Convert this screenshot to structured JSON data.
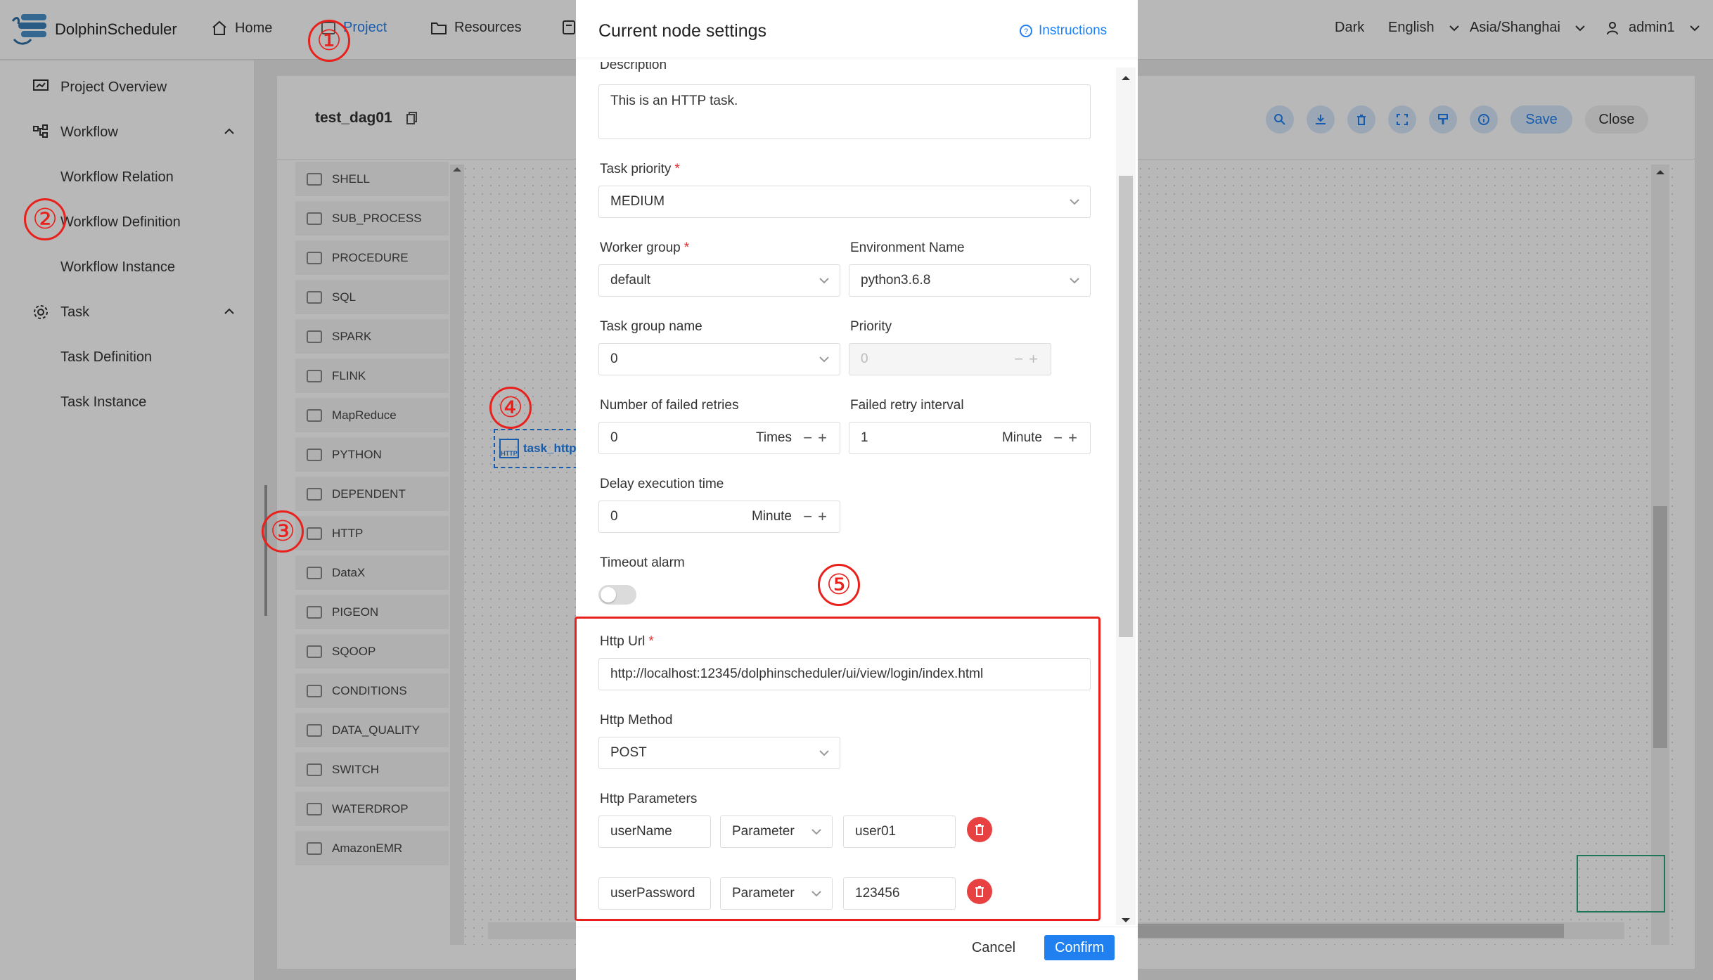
{
  "header": {
    "app_name": "DolphinScheduler",
    "nav": [
      {
        "label": "Home",
        "icon": "home-icon"
      },
      {
        "label": "Project",
        "icon": "project-icon"
      },
      {
        "label": "Resources",
        "icon": "folder-icon"
      }
    ],
    "theme": "Dark",
    "language": "English",
    "timezone": "Asia/Shanghai",
    "user": "admin1"
  },
  "sidebar": {
    "items": [
      {
        "label": "Project Overview",
        "icon": "chart-icon"
      },
      {
        "label": "Workflow",
        "icon": "workflow-icon"
      },
      {
        "label": "Workflow Relation"
      },
      {
        "label": "Workflow Definition"
      },
      {
        "label": "Workflow Instance"
      },
      {
        "label": "Task",
        "icon": "gear-icon"
      },
      {
        "label": "Task Definition"
      },
      {
        "label": "Task Instance"
      }
    ]
  },
  "canvas": {
    "dag_name": "test_dag01",
    "save_label": "Save",
    "close_label": "Close",
    "node_label": "task_http",
    "node_badge": "HTTP",
    "palette": [
      "SHELL",
      "SUB_PROCESS",
      "PROCEDURE",
      "SQL",
      "SPARK",
      "FLINK",
      "MapReduce",
      "PYTHON",
      "DEPENDENT",
      "HTTP",
      "DataX",
      "PIGEON",
      "SQOOP",
      "CONDITIONS",
      "DATA_QUALITY",
      "SWITCH",
      "WATERDROP",
      "AmazonEMR"
    ]
  },
  "annotations": [
    "①",
    "②",
    "③",
    "④",
    "⑤"
  ],
  "drawer": {
    "title": "Current node settings",
    "instructions": "Instructions",
    "description_label": "Description",
    "description_value": "This is an HTTP task.",
    "task_priority_label": "Task priority",
    "task_priority_value": "MEDIUM",
    "worker_group_label": "Worker group",
    "worker_group_value": "default",
    "environment_label": "Environment Name",
    "environment_value": "python3.6.8",
    "task_group_label": "Task group name",
    "task_group_value": "0",
    "priority_label": "Priority",
    "priority_value": "0",
    "failed_retries_label": "Number of failed retries",
    "failed_retries_value": "0",
    "failed_retries_unit": "Times",
    "retry_interval_label": "Failed retry interval",
    "retry_interval_value": "1",
    "retry_interval_unit": "Minute",
    "delay_label": "Delay execution time",
    "delay_value": "0",
    "delay_unit": "Minute",
    "timeout_label": "Timeout alarm",
    "http_url_label": "Http Url",
    "http_url_value": "http://localhost:12345/dolphinscheduler/ui/view/login/index.html",
    "http_method_label": "Http Method",
    "http_method_value": "POST",
    "http_params_label": "Http Parameters",
    "params": [
      {
        "prop": "userName",
        "type": "Parameter",
        "value": "user01"
      },
      {
        "prop": "userPassword",
        "type": "Parameter",
        "value": "123456"
      }
    ],
    "cancel_label": "Cancel",
    "confirm_label": "Confirm"
  },
  "colors": {
    "accent": "#2080f0",
    "annotation": "#e8211c",
    "danger": "#e84141"
  }
}
